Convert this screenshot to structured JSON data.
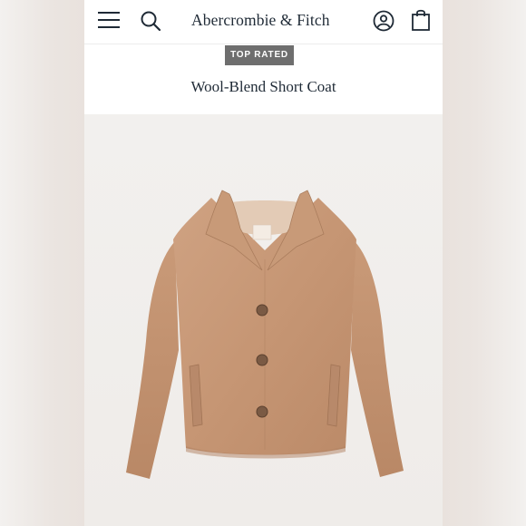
{
  "header": {
    "brand_name": "Abercrombie & Fitch",
    "icons": [
      "menu-icon",
      "search-icon",
      "account-icon",
      "shopping-bag-icon"
    ]
  },
  "product": {
    "badge": "TOP RATED",
    "title": "Wool-Blend Short Coat",
    "image": "camel wool-blend short coat with collar and four tortoiseshell buttons"
  },
  "colors": {
    "brand_text": "#1f2a36",
    "badge_bg": "#6e6e6e",
    "coat_camel": "#c99a78"
  }
}
